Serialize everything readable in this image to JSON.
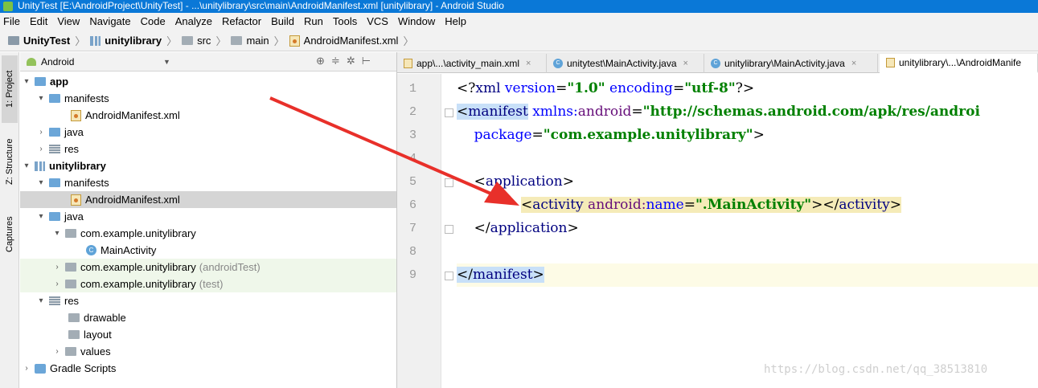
{
  "window": {
    "title": "UnityTest [E:\\AndroidProject\\UnityTest] - ...\\unitylibrary\\src\\main\\AndroidManifest.xml [unitylibrary] - Android Studio"
  },
  "menu": [
    "File",
    "Edit",
    "View",
    "Navigate",
    "Code",
    "Analyze",
    "Refactor",
    "Build",
    "Run",
    "Tools",
    "VCS",
    "Window",
    "Help"
  ],
  "breadcrumb": [
    "UnityTest",
    "unitylibrary",
    "src",
    "main",
    "AndroidManifest.xml"
  ],
  "sidebar_tabs": [
    "1: Project",
    "Z: Structure",
    "Captures"
  ],
  "project_panel": {
    "view": "Android"
  },
  "tree": [
    {
      "label": "app",
      "bold": true
    },
    {
      "label": "manifests"
    },
    {
      "label": "AndroidManifest.xml"
    },
    {
      "label": "java"
    },
    {
      "label": "res"
    },
    {
      "label": "unitylibrary",
      "bold": true
    },
    {
      "label": "manifests"
    },
    {
      "label": "AndroidManifest.xml",
      "selected": true
    },
    {
      "label": "java"
    },
    {
      "label": "com.example.unitylibrary"
    },
    {
      "label": "MainActivity"
    },
    {
      "label": "com.example.unitylibrary",
      "suffix": "(androidTest)"
    },
    {
      "label": "com.example.unitylibrary",
      "suffix": "(test)"
    },
    {
      "label": "res"
    },
    {
      "label": "drawable"
    },
    {
      "label": "layout"
    },
    {
      "label": "values"
    },
    {
      "label": "Gradle Scripts"
    }
  ],
  "editor_tabs": [
    {
      "label": "app\\...\\activity_main.xml"
    },
    {
      "label": "unitytest\\MainActivity.java"
    },
    {
      "label": "unitylibrary\\MainActivity.java"
    },
    {
      "label": "unitylibrary\\...\\AndroidManife",
      "active": true
    }
  ],
  "code": {
    "line_numbers": [
      "1",
      "2",
      "3",
      "4",
      "5",
      "6",
      "7",
      "8",
      "9"
    ],
    "l1_a": "<?",
    "l1_b": "xml ",
    "l1_c": "version",
    "l1_d": "=",
    "l1_e": "\"1.0\"",
    "l1_f": " encoding",
    "l1_g": "=",
    "l1_h": "\"utf-8\"",
    "l1_i": "?>",
    "l2_a": "<",
    "l2_b": "manifest",
    "l2_c": " xmlns:",
    "l2_d": "android",
    "l2_e": "=",
    "l2_f": "\"http://schemas.android.com/apk/res/androi",
    "l3_a": "    package",
    "l3_b": "=",
    "l3_c": "\"com.example.unitylibrary\"",
    "l3_d": ">",
    "l5_a": "    <",
    "l5_b": "application",
    "l5_c": ">",
    "l6_a": "<",
    "l6_b": "activity",
    "l6_c": " android:",
    "l6_d": "name",
    "l6_e": "=",
    "l6_f": "\".MainActivity\"",
    "l6_g": "></",
    "l6_h": "activity",
    "l6_i": ">",
    "l7_a": "    </",
    "l7_b": "application",
    "l7_c": ">",
    "l9_a": "</",
    "l9_b": "manifest",
    "l9_c": ">"
  },
  "watermark": "https://blog.csdn.net/qq_38513810",
  "colors": {
    "title_bar": "#0a78d7",
    "selection": "#d5d5d5",
    "arrow": "#e8302a"
  }
}
